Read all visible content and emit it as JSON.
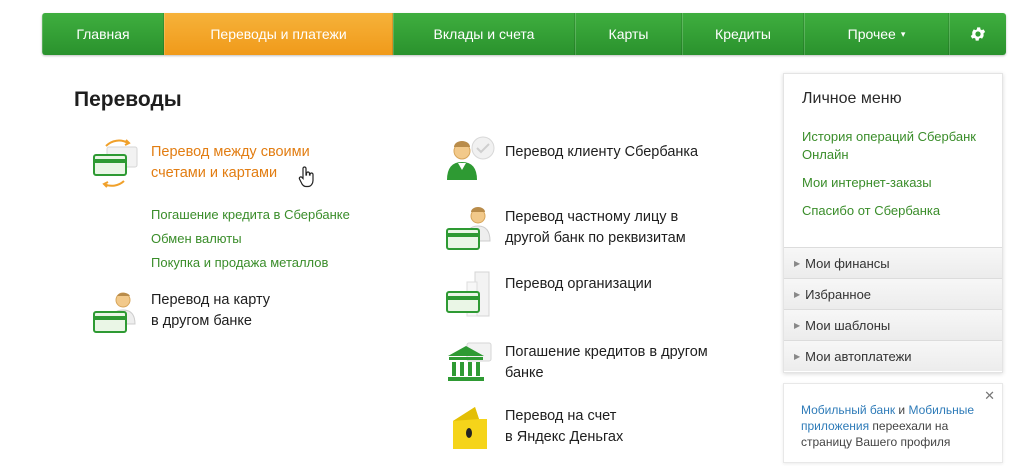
{
  "nav": {
    "items": [
      {
        "label": "Главная"
      },
      {
        "label": "Переводы и платежи"
      },
      {
        "label": "Вклады и счета"
      },
      {
        "label": "Карты"
      },
      {
        "label": "Кредиты"
      },
      {
        "label": "Прочее"
      }
    ],
    "more_caret": "▾",
    "settings_icon": "gear-icon"
  },
  "page": {
    "title": "Переводы"
  },
  "transfers": {
    "own_accounts": {
      "line1": "Перевод между своими",
      "line2": "счетами и картами"
    },
    "sub_links": [
      "Погашение кредита в Сбербанке",
      "Обмен валюты",
      "Покупка и продажа металлов"
    ],
    "card_other_bank": {
      "line1": "Перевод на карту",
      "line2": "в другом банке"
    },
    "sber_client": {
      "line1": "Перевод клиенту Сбербанка"
    },
    "private_person": {
      "line1": "Перевод частному лицу в",
      "line2": "другой банк по реквизитам"
    },
    "organization": {
      "line1": "Перевод организации"
    },
    "loan_other_bank": {
      "line1": "Погашение кредитов в другом",
      "line2": "банке"
    },
    "yandex": {
      "line1": "Перевод на счет",
      "line2": "в Яндекс Деньгах"
    }
  },
  "personal_menu": {
    "title": "Личное меню",
    "links": [
      "История операций Сбербанк Онлайн",
      "Мои интернет-заказы",
      "Спасибо от Сбербанка"
    ],
    "sections": [
      "Мои финансы",
      "Избранное",
      "Мои шаблоны",
      "Мои автоплатежи"
    ]
  },
  "notice": {
    "link1": "Мобильный банк",
    "and": " и ",
    "link2": "Мобильные приложения",
    "rest": " переехали на страницу Вашего профиля",
    "close": "✕"
  },
  "colors": {
    "green": "#2e9a33",
    "orange": "#f0a02a",
    "link_green": "#3a8d2a",
    "blue_link": "#2e7bb8"
  }
}
